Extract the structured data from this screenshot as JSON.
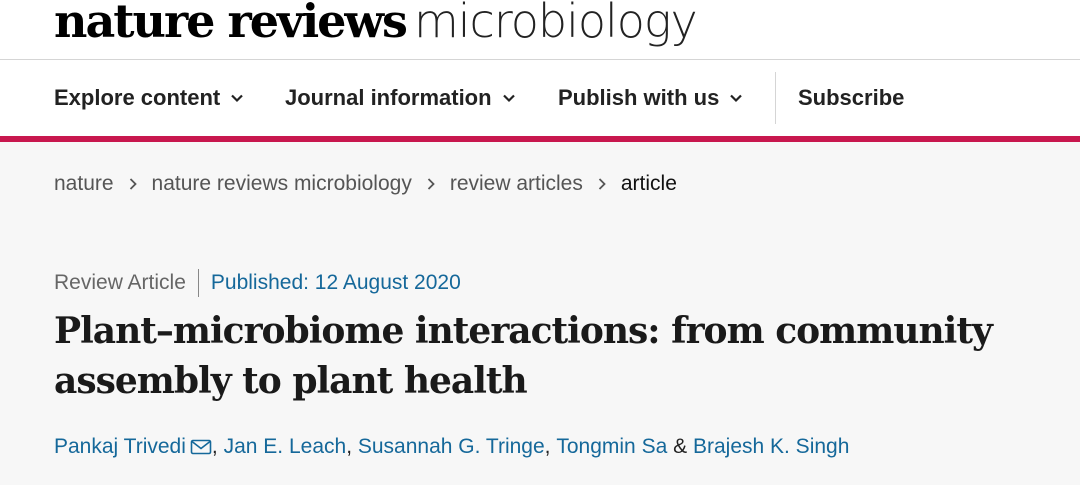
{
  "brand": {
    "logo_bold": "nature reviews",
    "logo_light": "microbiology"
  },
  "nav": {
    "items": [
      {
        "label": "Explore content",
        "icon": "chevron-down-icon"
      },
      {
        "label": "Journal information",
        "icon": "chevron-down-icon"
      },
      {
        "label": "Publish with us",
        "icon": "chevron-down-icon"
      },
      {
        "label": "Subscribe"
      }
    ],
    "accent_color": "#c8174e"
  },
  "breadcrumb": {
    "items": [
      "nature",
      "nature reviews microbiology",
      "review articles",
      "article"
    ],
    "separator_icon": "chevron-right-icon"
  },
  "article": {
    "type": "Review Article",
    "published": "Published: 12 August 2020",
    "title_line1": "Plant–microbiome interactions: from community",
    "title_line2": "assembly to plant health",
    "authors": [
      "Pankaj Trivedi",
      "Jan E. Leach",
      "Susannah G. Tringe",
      "Tongmin Sa",
      "Brajesh K. Singh"
    ],
    "author_separator": ",",
    "last_separator": "&",
    "corresponding_icon": "mail-icon",
    "link_color": "#15689a"
  }
}
